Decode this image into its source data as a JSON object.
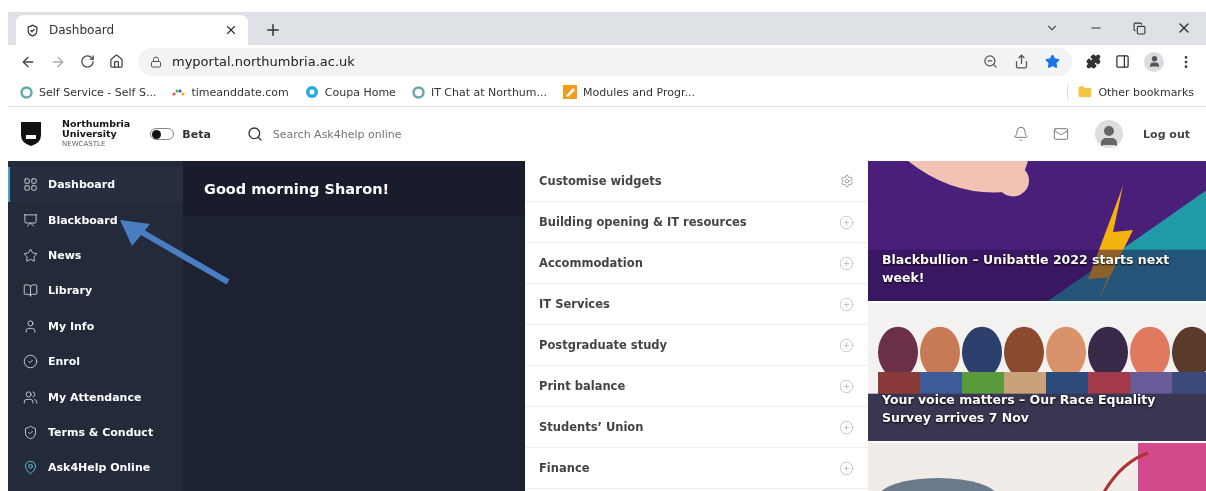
{
  "browser": {
    "tab": {
      "title": "Dashboard"
    },
    "url": "myportal.northumbria.ac.uk",
    "bookmarks": [
      {
        "label": "Self Service - Self S...",
        "kind": "ring"
      },
      {
        "label": "timeanddate.com",
        "kind": "dots"
      },
      {
        "label": "Coupa Home",
        "kind": "burst"
      },
      {
        "label": "IT Chat at Northum...",
        "kind": "ring"
      },
      {
        "label": "Modules and Progr...",
        "kind": "pencil"
      }
    ],
    "other_bookmarks": "Other bookmarks",
    "bookmarked": true
  },
  "header": {
    "logo": [
      "Northumbria",
      "University",
      "NEWCASTLE"
    ],
    "beta": {
      "label": "Beta",
      "on": false
    },
    "search": {
      "placeholder": "Search Ask4help online"
    },
    "logout": "Log out"
  },
  "sidebar": {
    "items": [
      {
        "label": "Dashboard",
        "selected": true
      },
      {
        "label": "Blackboard",
        "selected": false
      },
      {
        "label": "News",
        "selected": false
      },
      {
        "label": "Library",
        "selected": false
      },
      {
        "label": "My Info",
        "selected": false
      },
      {
        "label": "Enrol",
        "selected": false
      },
      {
        "label": "My Attendance",
        "selected": false
      },
      {
        "label": "Terms & Conduct",
        "selected": false
      },
      {
        "label": "Ask4Help Online",
        "selected": false
      }
    ]
  },
  "greeting": "Good morning Sharon!",
  "widgets": [
    {
      "label": "Customise widgets",
      "kind": "settings"
    },
    {
      "label": "Building opening & IT resources",
      "kind": "expand"
    },
    {
      "label": "Accommodation",
      "kind": "expand"
    },
    {
      "label": "IT Services",
      "kind": "expand"
    },
    {
      "label": "Postgraduate study",
      "kind": "expand"
    },
    {
      "label": "Print balance",
      "kind": "expand"
    },
    {
      "label": "Students’ Union",
      "kind": "expand"
    },
    {
      "label": "Finance",
      "kind": "expand"
    }
  ],
  "news": [
    {
      "title": "Blackbullion – Unibattle 2022 starts next week!",
      "kind": "purple"
    },
    {
      "title": "Your voice matters – Our Race Equality Survey arrives 7 Nov",
      "kind": "crowd"
    },
    {
      "kind": "light"
    }
  ]
}
